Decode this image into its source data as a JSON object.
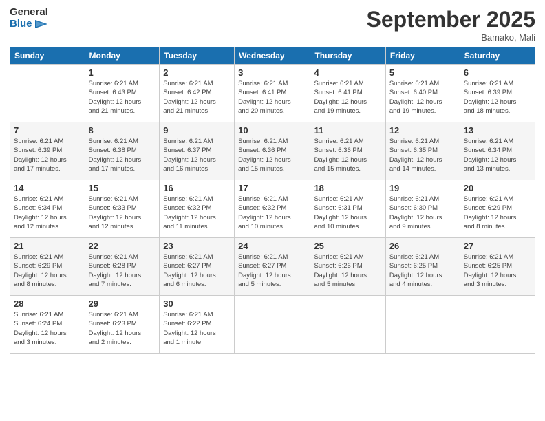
{
  "logo": {
    "line1": "General",
    "line2": "Blue"
  },
  "title": "September 2025",
  "location": "Bamako, Mali",
  "days_header": [
    "Sunday",
    "Monday",
    "Tuesday",
    "Wednesday",
    "Thursday",
    "Friday",
    "Saturday"
  ],
  "weeks": [
    [
      {
        "num": "",
        "info": ""
      },
      {
        "num": "1",
        "info": "Sunrise: 6:21 AM\nSunset: 6:43 PM\nDaylight: 12 hours\nand 21 minutes."
      },
      {
        "num": "2",
        "info": "Sunrise: 6:21 AM\nSunset: 6:42 PM\nDaylight: 12 hours\nand 21 minutes."
      },
      {
        "num": "3",
        "info": "Sunrise: 6:21 AM\nSunset: 6:41 PM\nDaylight: 12 hours\nand 20 minutes."
      },
      {
        "num": "4",
        "info": "Sunrise: 6:21 AM\nSunset: 6:41 PM\nDaylight: 12 hours\nand 19 minutes."
      },
      {
        "num": "5",
        "info": "Sunrise: 6:21 AM\nSunset: 6:40 PM\nDaylight: 12 hours\nand 19 minutes."
      },
      {
        "num": "6",
        "info": "Sunrise: 6:21 AM\nSunset: 6:39 PM\nDaylight: 12 hours\nand 18 minutes."
      }
    ],
    [
      {
        "num": "7",
        "info": "Sunrise: 6:21 AM\nSunset: 6:39 PM\nDaylight: 12 hours\nand 17 minutes."
      },
      {
        "num": "8",
        "info": "Sunrise: 6:21 AM\nSunset: 6:38 PM\nDaylight: 12 hours\nand 17 minutes."
      },
      {
        "num": "9",
        "info": "Sunrise: 6:21 AM\nSunset: 6:37 PM\nDaylight: 12 hours\nand 16 minutes."
      },
      {
        "num": "10",
        "info": "Sunrise: 6:21 AM\nSunset: 6:36 PM\nDaylight: 12 hours\nand 15 minutes."
      },
      {
        "num": "11",
        "info": "Sunrise: 6:21 AM\nSunset: 6:36 PM\nDaylight: 12 hours\nand 15 minutes."
      },
      {
        "num": "12",
        "info": "Sunrise: 6:21 AM\nSunset: 6:35 PM\nDaylight: 12 hours\nand 14 minutes."
      },
      {
        "num": "13",
        "info": "Sunrise: 6:21 AM\nSunset: 6:34 PM\nDaylight: 12 hours\nand 13 minutes."
      }
    ],
    [
      {
        "num": "14",
        "info": "Sunrise: 6:21 AM\nSunset: 6:34 PM\nDaylight: 12 hours\nand 12 minutes."
      },
      {
        "num": "15",
        "info": "Sunrise: 6:21 AM\nSunset: 6:33 PM\nDaylight: 12 hours\nand 12 minutes."
      },
      {
        "num": "16",
        "info": "Sunrise: 6:21 AM\nSunset: 6:32 PM\nDaylight: 12 hours\nand 11 minutes."
      },
      {
        "num": "17",
        "info": "Sunrise: 6:21 AM\nSunset: 6:32 PM\nDaylight: 12 hours\nand 10 minutes."
      },
      {
        "num": "18",
        "info": "Sunrise: 6:21 AM\nSunset: 6:31 PM\nDaylight: 12 hours\nand 10 minutes."
      },
      {
        "num": "19",
        "info": "Sunrise: 6:21 AM\nSunset: 6:30 PM\nDaylight: 12 hours\nand 9 minutes."
      },
      {
        "num": "20",
        "info": "Sunrise: 6:21 AM\nSunset: 6:29 PM\nDaylight: 12 hours\nand 8 minutes."
      }
    ],
    [
      {
        "num": "21",
        "info": "Sunrise: 6:21 AM\nSunset: 6:29 PM\nDaylight: 12 hours\nand 8 minutes."
      },
      {
        "num": "22",
        "info": "Sunrise: 6:21 AM\nSunset: 6:28 PM\nDaylight: 12 hours\nand 7 minutes."
      },
      {
        "num": "23",
        "info": "Sunrise: 6:21 AM\nSunset: 6:27 PM\nDaylight: 12 hours\nand 6 minutes."
      },
      {
        "num": "24",
        "info": "Sunrise: 6:21 AM\nSunset: 6:27 PM\nDaylight: 12 hours\nand 5 minutes."
      },
      {
        "num": "25",
        "info": "Sunrise: 6:21 AM\nSunset: 6:26 PM\nDaylight: 12 hours\nand 5 minutes."
      },
      {
        "num": "26",
        "info": "Sunrise: 6:21 AM\nSunset: 6:25 PM\nDaylight: 12 hours\nand 4 minutes."
      },
      {
        "num": "27",
        "info": "Sunrise: 6:21 AM\nSunset: 6:25 PM\nDaylight: 12 hours\nand 3 minutes."
      }
    ],
    [
      {
        "num": "28",
        "info": "Sunrise: 6:21 AM\nSunset: 6:24 PM\nDaylight: 12 hours\nand 3 minutes."
      },
      {
        "num": "29",
        "info": "Sunrise: 6:21 AM\nSunset: 6:23 PM\nDaylight: 12 hours\nand 2 minutes."
      },
      {
        "num": "30",
        "info": "Sunrise: 6:21 AM\nSunset: 6:22 PM\nDaylight: 12 hours\nand 1 minute."
      },
      {
        "num": "",
        "info": ""
      },
      {
        "num": "",
        "info": ""
      },
      {
        "num": "",
        "info": ""
      },
      {
        "num": "",
        "info": ""
      }
    ]
  ]
}
